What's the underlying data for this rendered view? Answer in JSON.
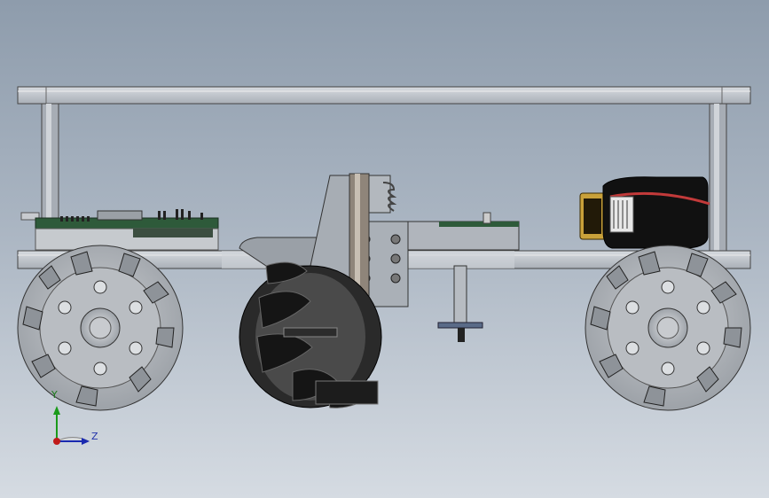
{
  "viewport": {
    "background_top": "#8e9cac",
    "background_bottom": "#d5dbe2"
  },
  "model": {
    "parts": [
      {
        "name": "top-plate"
      },
      {
        "name": "bottom-plate"
      },
      {
        "name": "standoff-left"
      },
      {
        "name": "standoff-right"
      },
      {
        "name": "mecanum-wheel-left"
      },
      {
        "name": "mecanum-wheel-right"
      },
      {
        "name": "caster-wheel-center"
      },
      {
        "name": "control-board"
      },
      {
        "name": "battery-pack"
      },
      {
        "name": "suspension-bracket"
      }
    ],
    "colors": {
      "plate": "#b9bec6",
      "wheel": "#b4b8bd",
      "wheel_dark": "#3a3a3a",
      "pcb": "#2e5a3a",
      "battery": "#111111",
      "battery_terminal": "#c9a13a",
      "wire": "#c23a3a"
    }
  },
  "triad": {
    "y_label": "Y",
    "z_label": "Z",
    "y_color": "#1a9a1a",
    "z_color": "#1a2ab0",
    "x_color": "#c01a1a"
  }
}
